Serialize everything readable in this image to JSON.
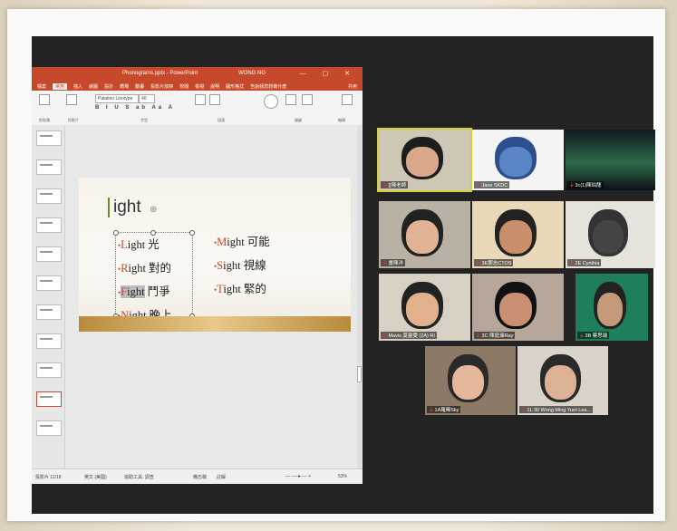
{
  "ppt": {
    "title": "Phonograms.pptx - PowerPoint",
    "account": "WONG NG",
    "window_controls": "— ▢ ✕",
    "tabs": [
      "檔案",
      "常用",
      "插入",
      "繪圖",
      "設計",
      "轉場",
      "動畫",
      "投影片放映",
      "校閱",
      "檢視",
      "說明",
      "圖形格式",
      "告訴我您想做什麼"
    ],
    "active_tab_index": 1,
    "share": "共用",
    "ribbon": {
      "font_name": "Palatino Linotype",
      "font_size": "40",
      "format_buttons": "B I U S ab Aa A",
      "groups": [
        "剪貼簿",
        "投影片",
        "字型",
        "段落",
        "繪圖",
        "編輯"
      ]
    },
    "thumbnail_count": 11,
    "selected_thumbnail": 9,
    "status": {
      "slide_info": "投影片 11/18",
      "language": "英文 (美國)",
      "accessibility": "協助工具: 調查",
      "notes": "備忘稿",
      "comments": "註解",
      "zoom": "53%"
    }
  },
  "slide": {
    "title": "ight",
    "left_words": [
      {
        "cap": "L",
        "rest": "ight",
        "zh": "光",
        "highlight": false
      },
      {
        "cap": "R",
        "rest": "ight",
        "zh": "對的",
        "highlight": false
      },
      {
        "cap": "F",
        "rest": "ight",
        "zh": "鬥爭",
        "highlight": true
      },
      {
        "cap": "N",
        "rest": "ight",
        "zh": "晚上",
        "highlight": false
      }
    ],
    "right_words": [
      {
        "cap": "M",
        "rest": "ight",
        "zh": "可能"
      },
      {
        "cap": "S",
        "rest": "ight",
        "zh": "視線"
      },
      {
        "cap": "T",
        "rest": "ight",
        "zh": "緊的"
      }
    ]
  },
  "zoom": {
    "participants": [
      "[]陳老師",
      "Jane SKDC",
      "3c(1)陳珀龍",
      "畫陳洋",
      "3E鄧志CTOS",
      "2E Cynthia",
      "Mavis 莫曼雯 (2A) RI",
      "3C 陳庭瑋Ray",
      "3B 蔡思瑜",
      "1A羅晞Sky",
      "1L 30 Wong Ming Yuet Lea..."
    ],
    "active_speaker_index": 0
  }
}
